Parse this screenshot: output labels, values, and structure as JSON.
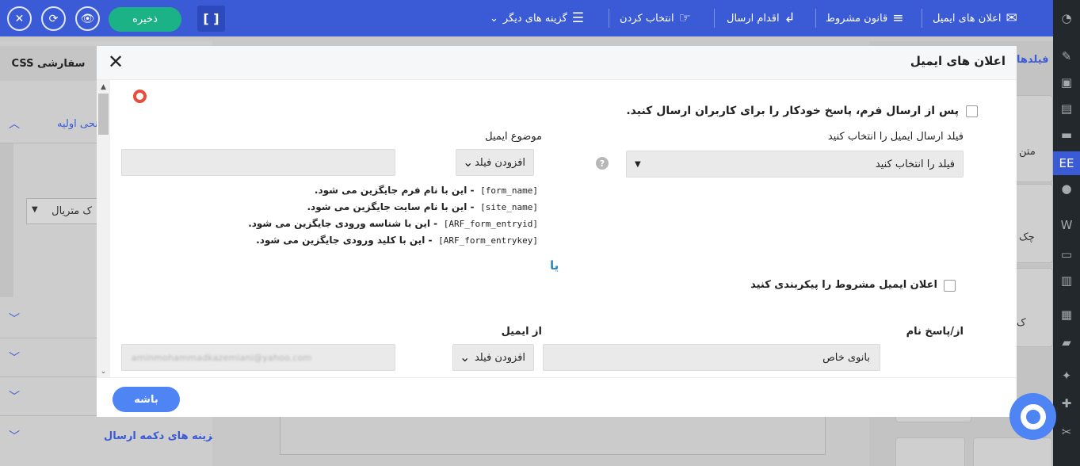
{
  "topbar": {
    "buttons": {
      "close": "✕",
      "refresh": "⟳",
      "preview": "👁",
      "save": "ذخیره",
      "brackets": "[ ]"
    },
    "menu": [
      {
        "label": "اعلان های ایمیل",
        "icon": "envelope-icon",
        "glyph": "✉"
      },
      {
        "label": "قانون مشروط",
        "icon": "filter-icon",
        "glyph": "≡"
      },
      {
        "label": "اقدام ارسال",
        "icon": "send-action-icon",
        "glyph": "↲"
      },
      {
        "label": "انتخاب کردن",
        "icon": "hand-icon",
        "glyph": "☞"
      },
      {
        "label": "گزینه های دیگر",
        "icon": "sliders-icon",
        "glyph": "☰",
        "caret": "⌄"
      }
    ]
  },
  "adminbar": {
    "icons": [
      "dashboard-icon",
      "pin-icon",
      "media-icon",
      "pages-icon",
      "comments-icon",
      "arforms-icon",
      "elementor-icon",
      "woo-icon",
      "products-icon",
      "analytics-icon",
      "marketing-icon",
      "appearance-icon",
      "plugins-icon",
      "users-icon",
      "tools-icon"
    ],
    "active_label": "EE"
  },
  "background": {
    "css_tab": "CSS سفارشی",
    "fields_tab": "فیلدها",
    "left_items": [
      "نحی اولیه",
      "ک متریال",
      "گزینه های دکمه ارسال"
    ],
    "right_texts": [
      "متن",
      "چک",
      "ک"
    ]
  },
  "modal": {
    "title": "اعلان های ایمیل",
    "close": "✕",
    "autoresponse_label": "پس از ارسال فرم، پاسخ خودکار را برای کاربران ارسال کنید.",
    "email_field_label": "فیلد ارسال ایمیل را انتخاب کنید",
    "email_field_select": "فیلد را انتخاب کنید",
    "subject_label": "موضوع ایمیل",
    "add_field": "افزودن فیلد",
    "subject_value": "",
    "shortcodes": [
      {
        "code": "[form_name]",
        "desc": "- این با نام فرم جایگزین می شود."
      },
      {
        "code": "[site_name]",
        "desc": "- این با نام سایت جایگزین می شود."
      },
      {
        "code": "[ARF_form_entryid]",
        "desc": "- این با شناسه ورودی جایگزین می شود."
      },
      {
        "code": "[ARF_form_entrykey]",
        "desc": "- این با کلید ورودی جایگزین می شود."
      }
    ],
    "or_text": "یا",
    "conditional_label": "اعلان ایمیل مشروط را پیکربندی کنید",
    "reply_name_label": "از/پاسخ نام",
    "reply_name_value": "بانوی خاص",
    "from_email_label": "از ایمیل",
    "from_email_value": "aminmohammadkazemiani@yahoo.com",
    "ok_button": "باشه"
  }
}
